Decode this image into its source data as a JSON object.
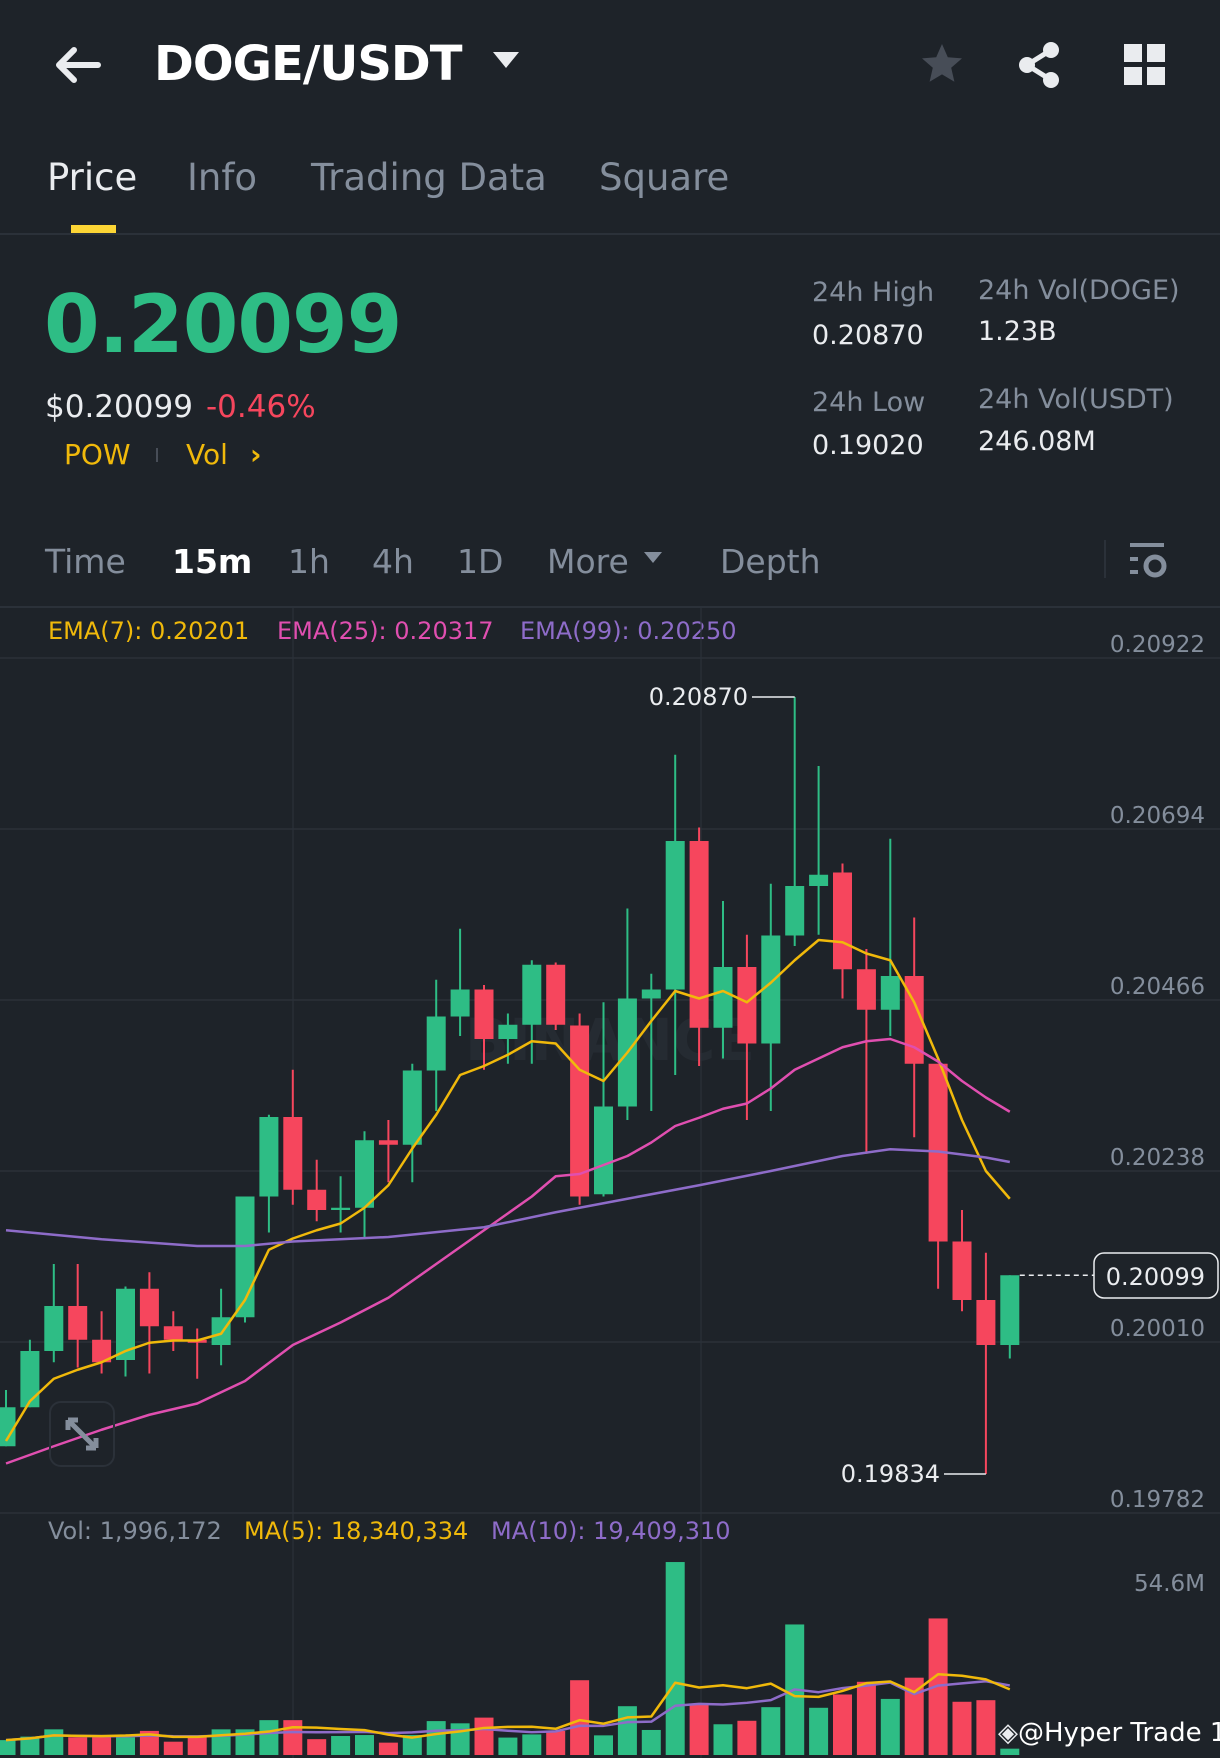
{
  "header": {
    "title": "DOGE/USDT",
    "icons": [
      "back-arrow-icon",
      "dropdown-caret-icon",
      "star-icon",
      "share-icon",
      "grid-icon"
    ]
  },
  "tabs": [
    {
      "label": "Price",
      "active": true
    },
    {
      "label": "Info"
    },
    {
      "label": "Trading Data"
    },
    {
      "label": "Square"
    }
  ],
  "ticker": {
    "last_price": "0.20099",
    "usd_price": "$0.20099",
    "change": "-0.46%",
    "tags": [
      "POW",
      "Vol"
    ],
    "high_label": "24h High",
    "high_value": "0.20870",
    "low_label": "24h Low",
    "low_value": "0.19020",
    "vol_base_label": "24h Vol(DOGE)",
    "vol_base_value": "1.23B",
    "vol_quote_label": "24h Vol(USDT)",
    "vol_quote_value": "246.08M"
  },
  "intervals": [
    {
      "label": "Time"
    },
    {
      "label": "15m",
      "active": true
    },
    {
      "label": "1h"
    },
    {
      "label": "4h"
    },
    {
      "label": "1D"
    },
    {
      "label": "More"
    },
    {
      "label": "Depth"
    }
  ],
  "colors": {
    "up": "#2ebd85",
    "down": "#f6465d",
    "ema7": "#f0b90b",
    "ema25": "#e04fb0",
    "ema99": "#8e6cc9",
    "bg": "#1e2329",
    "grid": "#2b3139"
  },
  "chart_data": {
    "type": "candlestick",
    "price_axis_ticks": [
      "0.20922",
      "0.20694",
      "0.20466",
      "0.20238",
      "0.20010",
      "0.19782"
    ],
    "price_axis_range": [
      0.19782,
      0.20922
    ],
    "legend": {
      "ema7": "EMA(7): 0.20201",
      "ema25": "EMA(25): 0.20317",
      "ema99": "EMA(99): 0.20250"
    },
    "annotations": {
      "high": "0.20870",
      "low": "0.19834",
      "current": "0.20099"
    },
    "ohlc": [
      [
        0.19871,
        0.19946,
        0.19871,
        0.19923
      ],
      [
        0.19923,
        0.20013,
        0.19923,
        0.19998
      ],
      [
        0.19998,
        0.20114,
        0.19983,
        0.20058
      ],
      [
        0.20058,
        0.20114,
        0.19976,
        0.20013
      ],
      [
        0.20013,
        0.20051,
        0.19968,
        0.19983
      ],
      [
        0.19986,
        0.20084,
        0.19964,
        0.20081
      ],
      [
        0.20081,
        0.20103,
        0.19968,
        0.20031
      ],
      [
        0.20031,
        0.20051,
        0.19998,
        0.20013
      ],
      [
        0.20013,
        0.20028,
        0.19961,
        0.20009
      ],
      [
        0.20006,
        0.20081,
        0.19979,
        0.20043
      ],
      [
        0.20043,
        0.20204,
        0.20036,
        0.20204
      ],
      [
        0.20204,
        0.20313,
        0.20156,
        0.2031
      ],
      [
        0.2031,
        0.20373,
        0.20193,
        0.20213
      ],
      [
        0.20213,
        0.20253,
        0.20171,
        0.20186
      ],
      [
        0.20186,
        0.20231,
        0.20156,
        0.20189
      ],
      [
        0.20189,
        0.20291,
        0.20148,
        0.20279
      ],
      [
        0.20279,
        0.20306,
        0.20223,
        0.20273
      ],
      [
        0.20273,
        0.20381,
        0.20223,
        0.20372
      ],
      [
        0.20372,
        0.20493,
        0.20318,
        0.20444
      ],
      [
        0.20444,
        0.20561,
        0.20418,
        0.2048
      ],
      [
        0.2048,
        0.20486,
        0.20373,
        0.20414
      ],
      [
        0.20414,
        0.20448,
        0.20381,
        0.20433
      ],
      [
        0.20433,
        0.20519,
        0.20381,
        0.20513
      ],
      [
        0.20513,
        0.20516,
        0.20426,
        0.20433
      ],
      [
        0.20432,
        0.20448,
        0.20193,
        0.20204
      ],
      [
        0.20207,
        0.20463,
        0.20204,
        0.20324
      ],
      [
        0.20324,
        0.20588,
        0.20306,
        0.20468
      ],
      [
        0.20468,
        0.20501,
        0.20318,
        0.2048
      ],
      [
        0.2048,
        0.20793,
        0.20366,
        0.20678
      ],
      [
        0.20678,
        0.20696,
        0.20378,
        0.20429
      ],
      [
        0.20429,
        0.20598,
        0.20388,
        0.2051
      ],
      [
        0.2051,
        0.20553,
        0.20306,
        0.20408
      ],
      [
        0.20408,
        0.20621,
        0.20318,
        0.20552
      ],
      [
        0.20552,
        0.2087,
        0.20538,
        0.20618
      ],
      [
        0.20618,
        0.20778,
        0.20553,
        0.20633
      ],
      [
        0.20636,
        0.20648,
        0.20468,
        0.20507
      ],
      [
        0.20507,
        0.20534,
        0.20261,
        0.20453
      ],
      [
        0.20453,
        0.20681,
        0.20418,
        0.20498
      ],
      [
        0.20498,
        0.20576,
        0.20283,
        0.20381
      ],
      [
        0.20381,
        0.20381,
        0.20081,
        0.20144
      ],
      [
        0.20144,
        0.20186,
        0.20051,
        0.20066
      ],
      [
        0.20066,
        0.20129,
        0.19834,
        0.20006
      ],
      [
        0.20006,
        0.20099,
        0.19988,
        0.20099
      ]
    ],
    "ema7": [
      0.19878,
      0.19931,
      0.19961,
      0.19973,
      0.19983,
      0.19998,
      0.20009,
      0.20012,
      0.20012,
      0.20021,
      0.20066,
      0.20133,
      0.20148,
      0.20159,
      0.20168,
      0.20189,
      0.20219,
      0.20268,
      0.20313,
      0.20366,
      0.20378,
      0.20393,
      0.20411,
      0.20408,
      0.20373,
      0.20358,
      0.20396,
      0.20438,
      0.20478,
      0.20468,
      0.20478,
      0.20463,
      0.20489,
      0.20519,
      0.20546,
      0.20543,
      0.20528,
      0.20519,
      0.20463,
      0.20388,
      0.20306,
      0.20238,
      0.20201
    ],
    "ema25": {
      "idx": [
        0,
        2,
        4,
        6,
        8,
        10,
        12,
        14,
        16,
        18,
        20,
        22,
        23,
        24,
        25,
        26,
        27,
        28,
        29,
        30,
        31,
        32,
        33,
        34,
        35,
        36,
        37,
        38,
        39,
        40,
        41,
        42
      ],
      "values": [
        0.19848,
        0.19871,
        0.19893,
        0.19913,
        0.19928,
        0.19958,
        0.20006,
        0.20036,
        0.20069,
        0.20114,
        0.20159,
        0.20204,
        0.20231,
        0.20234,
        0.20246,
        0.20258,
        0.20276,
        0.20298,
        0.20309,
        0.20321,
        0.20328,
        0.20348,
        0.20373,
        0.20388,
        0.20403,
        0.20411,
        0.20414,
        0.20403,
        0.20384,
        0.20358,
        0.20336,
        0.20317
      ]
    },
    "ema99": {
      "idx": [
        0,
        4,
        8,
        10,
        12,
        16,
        20,
        23,
        26,
        29,
        32,
        35,
        37,
        39,
        41,
        42
      ],
      "values": [
        0.20159,
        0.20147,
        0.20138,
        0.20138,
        0.20144,
        0.2015,
        0.20163,
        0.20183,
        0.20201,
        0.20219,
        0.20238,
        0.20258,
        0.20267,
        0.20264,
        0.20256,
        0.2025
      ]
    },
    "volume_legend": {
      "vol": "Vol: 1,996,172",
      "ma5": "MA(5): 18,340,334",
      "ma10": "MA(10): 19,409,310"
    },
    "volume_axis_label": "54.6M",
    "volume_axis_max_millions": 54.6,
    "volume_millions": [
      4.7,
      5.8,
      8.1,
      5.6,
      5.6,
      5.6,
      7.6,
      4.2,
      5.6,
      8.1,
      8.1,
      11.0,
      11.0,
      5.0,
      6.0,
      6.3,
      3.9,
      6.3,
      10.7,
      10.0,
      11.8,
      5.5,
      6.5,
      7.6,
      23.6,
      6.2,
      15.4,
      7.9,
      60.9,
      16.1,
      9.7,
      10.8,
      15.1,
      41.2,
      14.9,
      19.1,
      23.1,
      17.7,
      24.4,
      43.1,
      16.8,
      17.3,
      2.0
    ]
  },
  "watermark": {
    "chart": "BINANCE",
    "user": "@Hyper Trade 1"
  }
}
